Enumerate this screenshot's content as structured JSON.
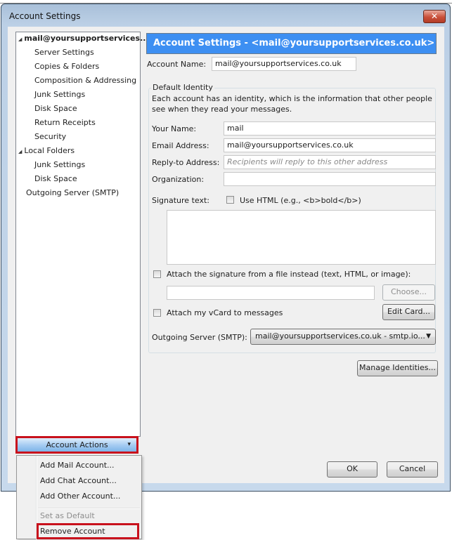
{
  "window": {
    "title": "Account Settings",
    "close_label": "✕"
  },
  "tree": {
    "items": [
      {
        "label": "mail@yoursupportservices...",
        "level": 0,
        "expanded": true,
        "bold": true
      },
      {
        "label": "Server Settings",
        "level": 1
      },
      {
        "label": "Copies & Folders",
        "level": 1
      },
      {
        "label": "Composition & Addressing",
        "level": 1
      },
      {
        "label": "Junk Settings",
        "level": 1
      },
      {
        "label": "Disk Space",
        "level": 1
      },
      {
        "label": "Return Receipts",
        "level": 1
      },
      {
        "label": "Security",
        "level": 1
      },
      {
        "label": "Local Folders",
        "level": 0,
        "expanded": true
      },
      {
        "label": "Junk Settings",
        "level": 1
      },
      {
        "label": "Disk Space",
        "level": 1
      },
      {
        "label": "Outgoing Server (SMTP)",
        "level": 0
      }
    ],
    "expand_glyph": "◢"
  },
  "main": {
    "banner": "Account Settings - <mail@yoursupportservices.co.uk>",
    "account_name_label": "Account Name:",
    "account_name_value": "mail@yoursupportservices.co.uk",
    "group_title": "Default Identity",
    "description": "Each account has an identity, which is the information that other people see when they read your messages.",
    "your_name_label": "Your Name:",
    "your_name_value": "mail",
    "email_label": "Email Address:",
    "email_value": "mail@yoursupportservices.co.uk",
    "reply_to_label": "Reply-to Address:",
    "reply_to_placeholder": "Recipients will reply to this other address",
    "org_label": "Organization:",
    "org_value": "",
    "signature_label": "Signature text:",
    "use_html_label": "Use HTML (e.g., <b>bold</b>)",
    "use_html_checked": false,
    "signature_value": "",
    "attach_sig_label": "Attach the signature from a file instead (text, HTML, or image):",
    "attach_sig_checked": false,
    "sig_file_value": "",
    "choose_label": "Choose...",
    "vcard_label": "Attach my vCard to messages",
    "vcard_checked": false,
    "edit_card_label": "Edit Card...",
    "smtp_label": "Outgoing Server (SMTP):",
    "smtp_value": "mail@yoursupportservices.co.uk - smtp.io...",
    "manage_identities_label": "Manage Identities...",
    "ok_label": "OK",
    "cancel_label": "Cancel"
  },
  "account_actions": {
    "label": "Account Actions",
    "arrow": "▾",
    "menu": [
      {
        "label": "Add Mail Account...",
        "enabled": true
      },
      {
        "label": "Add Chat Account...",
        "enabled": true
      },
      {
        "label": "Add Other Account...",
        "enabled": true
      },
      {
        "label": "Set as Default",
        "enabled": false
      },
      {
        "label": "Remove Account",
        "enabled": true,
        "highlighted": true
      }
    ]
  },
  "colors": {
    "banner": "#3d8ff2",
    "highlight_border": "#c8111c"
  }
}
